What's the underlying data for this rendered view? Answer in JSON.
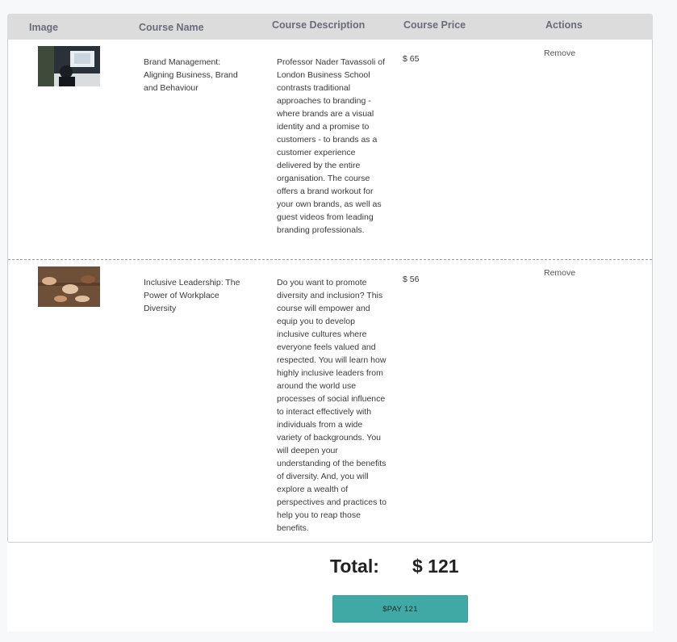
{
  "table": {
    "headers": {
      "image": "Image",
      "course_name": "Course Name",
      "course_description": "Course Description",
      "course_price": "Course Price",
      "actions": "Actions"
    },
    "rows": [
      {
        "name": "Brand Management: Aligning Business, Brand and Behaviour",
        "description": "Professor Nader Tavassoli of London Business School contrasts traditional approaches to branding - where brands are a visual identity and a promise to customers - to brands as a customer experience delivered by the entire organisation. The course offers a brand workout for your own brands, as well as guest videos from leading branding professionals.",
        "price": "$ 65",
        "action": "Remove"
      },
      {
        "name": "Inclusive Leadership: The Power of Workplace Diversity",
        "description": "Do you want to promote diversity and inclusion? This course will empower and equip you to develop inclusive cultures where everyone feels valued and respected. You will learn how highly inclusive leaders from around the world use processes of social influence to interact effectively with individuals from a wide variety of backgrounds. You will deepen your understanding of the benefits of diversity. And, you will explore a wealth of perspectives and practices to help you to reap those benefits.",
        "price": "$ 56",
        "action": "Remove"
      }
    ]
  },
  "summary": {
    "total_label": "Total:",
    "total_value": "$ 121",
    "pay_button_label": "$PAY 121"
  },
  "colors": {
    "header_bg": "#dcdcdc",
    "pay_button_bg": "#41a9a5"
  }
}
